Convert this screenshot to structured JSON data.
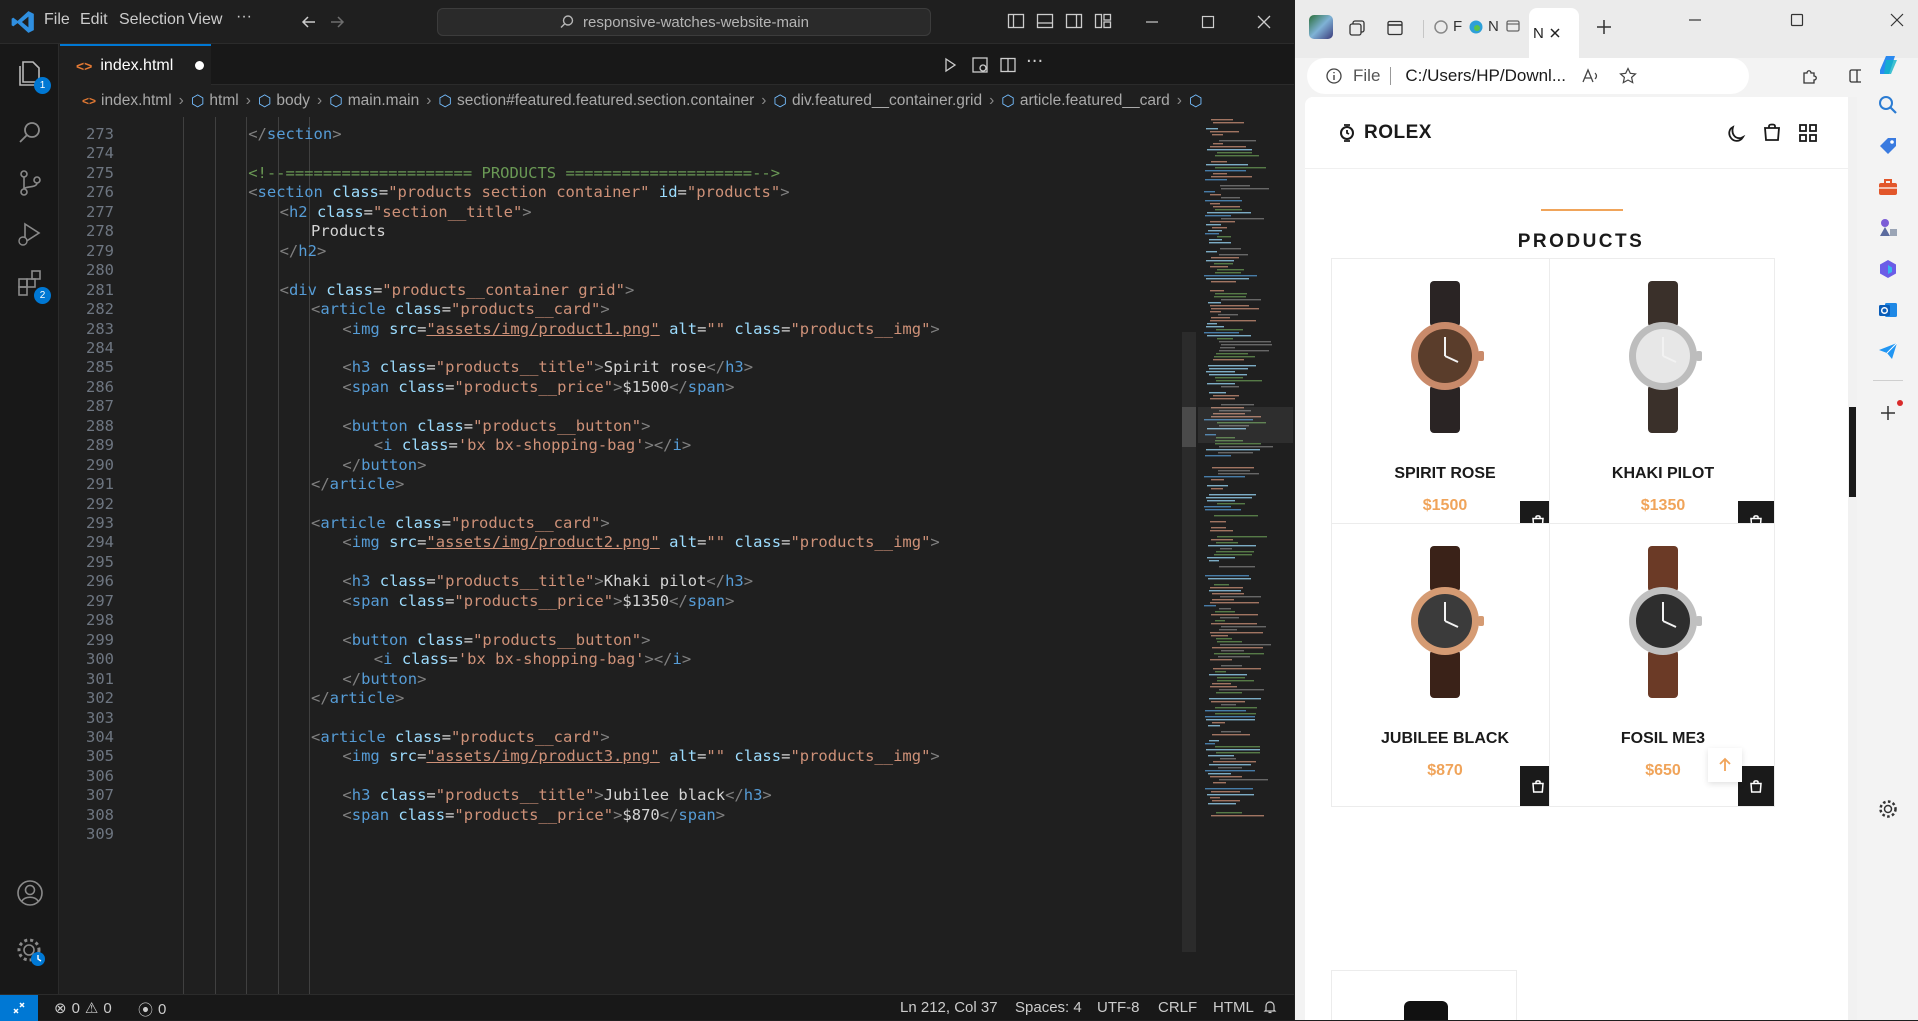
{
  "vscode": {
    "menu": [
      "File",
      "Edit",
      "Selection",
      "View",
      "···"
    ],
    "search_text": "responsive-watches-website-main",
    "tab_label": "index.html",
    "activity_badges": {
      "explorer": "1",
      "extensions": "2"
    },
    "breadcrumb": [
      "index.html",
      "html",
      "body",
      "main.main",
      "section#featured.featured.section.container",
      "div.featured__container.grid",
      "article.featured__card"
    ],
    "status": {
      "errors": "0",
      "warnings": "0",
      "ports": "0",
      "position": "Ln 212, Col 37",
      "spaces": "Spaces: 4",
      "encoding": "UTF-8",
      "eol": "CRLF",
      "language": "HTML"
    },
    "lines": [
      {
        "n": "273",
        "indent": 3,
        "tokens": [
          [
            "p",
            "</"
          ],
          [
            "t",
            "section"
          ],
          [
            "p",
            ">"
          ]
        ]
      },
      {
        "n": "274",
        "indent": 0,
        "tokens": []
      },
      {
        "n": "275",
        "indent": 3,
        "tokens": [
          [
            "c",
            "<!--==================== PRODUCTS ====================-->"
          ]
        ]
      },
      {
        "n": "276",
        "indent": 3,
        "tokens": [
          [
            "p",
            "<"
          ],
          [
            "t",
            "section"
          ],
          [
            "x",
            " "
          ],
          [
            "a",
            "class"
          ],
          [
            "x",
            "="
          ],
          [
            "s",
            "\"products section container\""
          ],
          [
            "x",
            " "
          ],
          [
            "a",
            "id"
          ],
          [
            "x",
            "="
          ],
          [
            "s",
            "\"products\""
          ],
          [
            "p",
            ">"
          ]
        ]
      },
      {
        "n": "277",
        "indent": 4,
        "tokens": [
          [
            "p",
            "<"
          ],
          [
            "t",
            "h2"
          ],
          [
            "x",
            " "
          ],
          [
            "a",
            "class"
          ],
          [
            "x",
            "="
          ],
          [
            "s",
            "\"section__title\""
          ],
          [
            "p",
            ">"
          ]
        ]
      },
      {
        "n": "278",
        "indent": 5,
        "tokens": [
          [
            "x",
            "Products"
          ]
        ]
      },
      {
        "n": "279",
        "indent": 4,
        "tokens": [
          [
            "p",
            "</"
          ],
          [
            "t",
            "h2"
          ],
          [
            "p",
            ">"
          ]
        ]
      },
      {
        "n": "280",
        "indent": 0,
        "tokens": []
      },
      {
        "n": "281",
        "indent": 4,
        "tokens": [
          [
            "p",
            "<"
          ],
          [
            "t",
            "div"
          ],
          [
            "x",
            " "
          ],
          [
            "a",
            "class"
          ],
          [
            "x",
            "="
          ],
          [
            "s",
            "\"products__container grid\""
          ],
          [
            "p",
            ">"
          ]
        ]
      },
      {
        "n": "282",
        "indent": 5,
        "tokens": [
          [
            "p",
            "<"
          ],
          [
            "t",
            "article"
          ],
          [
            "x",
            " "
          ],
          [
            "a",
            "class"
          ],
          [
            "x",
            "="
          ],
          [
            "s",
            "\"products__card\""
          ],
          [
            "p",
            ">"
          ]
        ]
      },
      {
        "n": "283",
        "indent": 6,
        "tokens": [
          [
            "p",
            "<"
          ],
          [
            "t",
            "img"
          ],
          [
            "x",
            " "
          ],
          [
            "a",
            "src"
          ],
          [
            "x",
            "="
          ],
          [
            "su",
            "\"assets/img/product1.png\""
          ],
          [
            "x",
            " "
          ],
          [
            "a",
            "alt"
          ],
          [
            "x",
            "="
          ],
          [
            "s",
            "\"\""
          ],
          [
            "x",
            " "
          ],
          [
            "a",
            "class"
          ],
          [
            "x",
            "="
          ],
          [
            "s",
            "\"products__img\""
          ],
          [
            "p",
            ">"
          ]
        ]
      },
      {
        "n": "284",
        "indent": 0,
        "tokens": []
      },
      {
        "n": "285",
        "indent": 6,
        "tokens": [
          [
            "p",
            "<"
          ],
          [
            "t",
            "h3"
          ],
          [
            "x",
            " "
          ],
          [
            "a",
            "class"
          ],
          [
            "x",
            "="
          ],
          [
            "s",
            "\"products__title\""
          ],
          [
            "p",
            ">"
          ],
          [
            "x",
            "Spirit rose"
          ],
          [
            "p",
            "</"
          ],
          [
            "t",
            "h3"
          ],
          [
            "p",
            ">"
          ]
        ]
      },
      {
        "n": "286",
        "indent": 6,
        "tokens": [
          [
            "p",
            "<"
          ],
          [
            "t",
            "span"
          ],
          [
            "x",
            " "
          ],
          [
            "a",
            "class"
          ],
          [
            "x",
            "="
          ],
          [
            "s",
            "\"products__price\""
          ],
          [
            "p",
            ">"
          ],
          [
            "x",
            "$1500"
          ],
          [
            "p",
            "</"
          ],
          [
            "t",
            "span"
          ],
          [
            "p",
            ">"
          ]
        ]
      },
      {
        "n": "287",
        "indent": 0,
        "tokens": []
      },
      {
        "n": "288",
        "indent": 6,
        "tokens": [
          [
            "p",
            "<"
          ],
          [
            "t",
            "button"
          ],
          [
            "x",
            " "
          ],
          [
            "a",
            "class"
          ],
          [
            "x",
            "="
          ],
          [
            "s",
            "\"products__button\""
          ],
          [
            "p",
            ">"
          ]
        ]
      },
      {
        "n": "289",
        "indent": 7,
        "tokens": [
          [
            "p",
            "<"
          ],
          [
            "t",
            "i"
          ],
          [
            "x",
            " "
          ],
          [
            "a",
            "class"
          ],
          [
            "x",
            "="
          ],
          [
            "s",
            "'bx bx-shopping-bag'"
          ],
          [
            "p",
            "></"
          ],
          [
            "t",
            "i"
          ],
          [
            "p",
            ">"
          ]
        ]
      },
      {
        "n": "290",
        "indent": 6,
        "tokens": [
          [
            "p",
            "</"
          ],
          [
            "t",
            "button"
          ],
          [
            "p",
            ">"
          ]
        ]
      },
      {
        "n": "291",
        "indent": 5,
        "tokens": [
          [
            "p",
            "</"
          ],
          [
            "t",
            "article"
          ],
          [
            "p",
            ">"
          ]
        ]
      },
      {
        "n": "292",
        "indent": 0,
        "tokens": []
      },
      {
        "n": "293",
        "indent": 5,
        "tokens": [
          [
            "p",
            "<"
          ],
          [
            "t",
            "article"
          ],
          [
            "x",
            " "
          ],
          [
            "a",
            "class"
          ],
          [
            "x",
            "="
          ],
          [
            "s",
            "\"products__card\""
          ],
          [
            "p",
            ">"
          ]
        ]
      },
      {
        "n": "294",
        "indent": 6,
        "tokens": [
          [
            "p",
            "<"
          ],
          [
            "t",
            "img"
          ],
          [
            "x",
            " "
          ],
          [
            "a",
            "src"
          ],
          [
            "x",
            "="
          ],
          [
            "su",
            "\"assets/img/product2.png\""
          ],
          [
            "x",
            " "
          ],
          [
            "a",
            "alt"
          ],
          [
            "x",
            "="
          ],
          [
            "s",
            "\"\""
          ],
          [
            "x",
            " "
          ],
          [
            "a",
            "class"
          ],
          [
            "x",
            "="
          ],
          [
            "s",
            "\"products__img\""
          ],
          [
            "p",
            ">"
          ]
        ]
      },
      {
        "n": "295",
        "indent": 0,
        "tokens": []
      },
      {
        "n": "296",
        "indent": 6,
        "tokens": [
          [
            "p",
            "<"
          ],
          [
            "t",
            "h3"
          ],
          [
            "x",
            " "
          ],
          [
            "a",
            "class"
          ],
          [
            "x",
            "="
          ],
          [
            "s",
            "\"products__title\""
          ],
          [
            "p",
            ">"
          ],
          [
            "x",
            "Khaki pilot"
          ],
          [
            "p",
            "</"
          ],
          [
            "t",
            "h3"
          ],
          [
            "p",
            ">"
          ]
        ]
      },
      {
        "n": "297",
        "indent": 6,
        "tokens": [
          [
            "p",
            "<"
          ],
          [
            "t",
            "span"
          ],
          [
            "x",
            " "
          ],
          [
            "a",
            "class"
          ],
          [
            "x",
            "="
          ],
          [
            "s",
            "\"products__price\""
          ],
          [
            "p",
            ">"
          ],
          [
            "x",
            "$1350"
          ],
          [
            "p",
            "</"
          ],
          [
            "t",
            "span"
          ],
          [
            "p",
            ">"
          ]
        ]
      },
      {
        "n": "298",
        "indent": 0,
        "tokens": []
      },
      {
        "n": "299",
        "indent": 6,
        "tokens": [
          [
            "p",
            "<"
          ],
          [
            "t",
            "button"
          ],
          [
            "x",
            " "
          ],
          [
            "a",
            "class"
          ],
          [
            "x",
            "="
          ],
          [
            "s",
            "\"products__button\""
          ],
          [
            "p",
            ">"
          ]
        ]
      },
      {
        "n": "300",
        "indent": 7,
        "tokens": [
          [
            "p",
            "<"
          ],
          [
            "t",
            "i"
          ],
          [
            "x",
            " "
          ],
          [
            "a",
            "class"
          ],
          [
            "x",
            "="
          ],
          [
            "s",
            "'bx bx-shopping-bag'"
          ],
          [
            "p",
            "></"
          ],
          [
            "t",
            "i"
          ],
          [
            "p",
            ">"
          ]
        ]
      },
      {
        "n": "301",
        "indent": 6,
        "tokens": [
          [
            "p",
            "</"
          ],
          [
            "t",
            "button"
          ],
          [
            "p",
            ">"
          ]
        ]
      },
      {
        "n": "302",
        "indent": 5,
        "tokens": [
          [
            "p",
            "</"
          ],
          [
            "t",
            "article"
          ],
          [
            "p",
            ">"
          ]
        ]
      },
      {
        "n": "303",
        "indent": 0,
        "tokens": []
      },
      {
        "n": "304",
        "indent": 5,
        "tokens": [
          [
            "p",
            "<"
          ],
          [
            "t",
            "article"
          ],
          [
            "x",
            " "
          ],
          [
            "a",
            "class"
          ],
          [
            "x",
            "="
          ],
          [
            "s",
            "\"products__card\""
          ],
          [
            "p",
            ">"
          ]
        ]
      },
      {
        "n": "305",
        "indent": 6,
        "tokens": [
          [
            "p",
            "<"
          ],
          [
            "t",
            "img"
          ],
          [
            "x",
            " "
          ],
          [
            "a",
            "src"
          ],
          [
            "x",
            "="
          ],
          [
            "su",
            "\"assets/img/product3.png\""
          ],
          [
            "x",
            " "
          ],
          [
            "a",
            "alt"
          ],
          [
            "x",
            "="
          ],
          [
            "s",
            "\"\""
          ],
          [
            "x",
            " "
          ],
          [
            "a",
            "class"
          ],
          [
            "x",
            "="
          ],
          [
            "s",
            "\"products__img\""
          ],
          [
            "p",
            ">"
          ]
        ]
      },
      {
        "n": "306",
        "indent": 0,
        "tokens": []
      },
      {
        "n": "307",
        "indent": 6,
        "tokens": [
          [
            "p",
            "<"
          ],
          [
            "t",
            "h3"
          ],
          [
            "x",
            " "
          ],
          [
            "a",
            "class"
          ],
          [
            "x",
            "="
          ],
          [
            "s",
            "\"products__title\""
          ],
          [
            "p",
            ">"
          ],
          [
            "x",
            "Jubilee black"
          ],
          [
            "p",
            "</"
          ],
          [
            "t",
            "h3"
          ],
          [
            "p",
            ">"
          ]
        ]
      },
      {
        "n": "308",
        "indent": 6,
        "tokens": [
          [
            "p",
            "<"
          ],
          [
            "t",
            "span"
          ],
          [
            "x",
            " "
          ],
          [
            "a",
            "class"
          ],
          [
            "x",
            "="
          ],
          [
            "s",
            "\"products__price\""
          ],
          [
            "p",
            ">"
          ],
          [
            "x",
            "$870"
          ],
          [
            "p",
            "</"
          ],
          [
            "t",
            "span"
          ],
          [
            "p",
            ">"
          ]
        ]
      },
      {
        "n": "309",
        "indent": 0,
        "tokens": []
      }
    ]
  },
  "browser": {
    "tab_labels": [
      "F",
      "N",
      "N"
    ],
    "address_prefix": "File",
    "address_url": "C:/Users/HP/Downl...",
    "site": {
      "logo": "ROLEX",
      "section_title": "PRODUCTS",
      "products": [
        {
          "title": "SPIRIT ROSE",
          "price": "$1500",
          "dial": "#5a3d2b",
          "case": "#c98a6a",
          "strap": "#2a2424"
        },
        {
          "title": "KHAKI PILOT",
          "price": "$1350",
          "dial": "#e7e7e7",
          "case": "#bdbdbd",
          "strap": "#3a302a"
        },
        {
          "title": "JUBILEE BLACK",
          "price": "$870",
          "dial": "#3b3b3b",
          "case": "#d59b73",
          "strap": "#3a2218"
        },
        {
          "title": "FOSIL ME3",
          "price": "$650",
          "dial": "#2e2e2e",
          "case": "#c0c0c0",
          "strap": "#6b3a26"
        }
      ]
    }
  },
  "colors": {
    "accent": "#0078d4",
    "price": "#f0a45a",
    "site_dark": "#1a1a1a"
  }
}
